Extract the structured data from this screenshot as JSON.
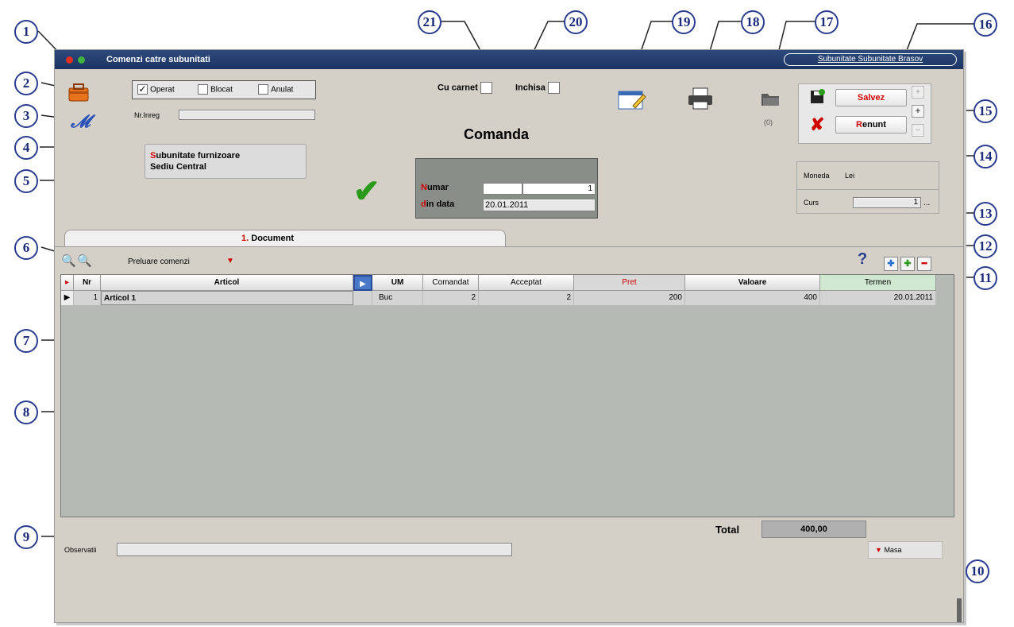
{
  "window": {
    "title": "Comenzi catre subunitati",
    "subunit_link": "Subunitate Subunitate Brasov",
    "header_title": "Comanda"
  },
  "status_flags": {
    "operat": "Operat",
    "blocat": "Blocat",
    "anulat": "Anulat"
  },
  "nr_inreg_label": "Nr.Inreg",
  "cu_carnet_label": "Cu carnet",
  "inchisa_label": "Inchisa",
  "supplier": {
    "label_prefix": "S",
    "label_rest": "ubunitate furnizoare",
    "value": "Sediu Central"
  },
  "document": {
    "numar_prefix": "N",
    "numar_rest": "umar",
    "numar_value": "1",
    "data_prefix": "d",
    "data_rest": "in data",
    "data_value": "20.01.2011"
  },
  "attachments_count": "(0)",
  "buttons": {
    "save": "Salvez",
    "cancel_prefix": "R",
    "cancel_rest": "enunt"
  },
  "currency": {
    "label": "Moneda",
    "value": "Lei",
    "rate_label": "Curs",
    "rate_value": "1",
    "ellipsis": "..."
  },
  "tab_label_num": "1.",
  "tab_label": "Document",
  "preluare": "Preluare comenzi",
  "help_glyph": "?",
  "grid": {
    "headers": {
      "nr": "Nr",
      "articol": "Articol",
      "um": "UM",
      "comandat": "Comandat",
      "acceptat": "Acceptat",
      "pret": "Pret",
      "valoare": "Valoare",
      "termen": "Termen"
    },
    "rows": [
      {
        "nr": "1",
        "articol": "Articol 1",
        "um": "Buc",
        "comandat": "2",
        "acceptat": "2",
        "pret": "200",
        "valoare": "400",
        "termen": "20.01.2011"
      }
    ]
  },
  "total_label": "Total",
  "total_value": "400,00",
  "observatii_label": "Observatii",
  "masa_label": "Masa",
  "callouts": [
    "1",
    "2",
    "3",
    "4",
    "5",
    "6",
    "7",
    "8",
    "9",
    "10",
    "11",
    "12",
    "13",
    "14",
    "15",
    "16",
    "17",
    "18",
    "19",
    "20",
    "21"
  ],
  "colors": {
    "title_bar": "#1c3462",
    "accent_red": "#d00000",
    "callout_border": "#2a3d8f",
    "grid_bg": "#b6bab4",
    "termen_header": "#cfe8cf"
  }
}
